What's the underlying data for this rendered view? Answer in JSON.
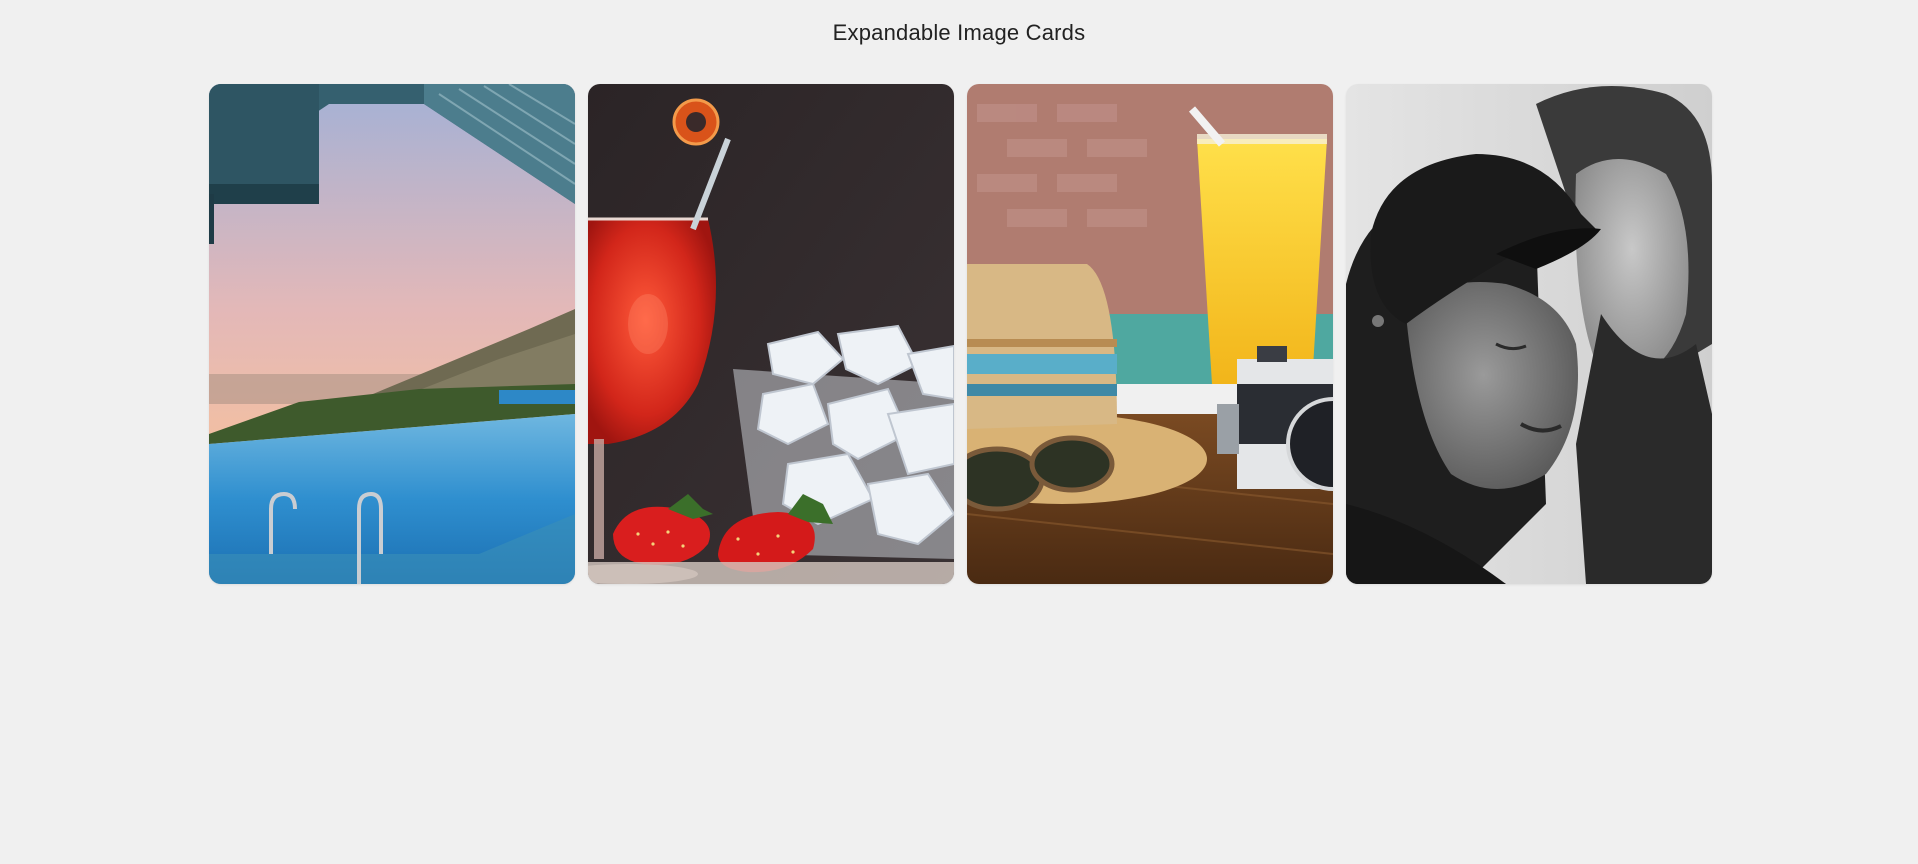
{
  "header": {
    "title": "Expandable Image Cards"
  },
  "cards": [
    {
      "image": "infinity-pool-sunset"
    },
    {
      "image": "red-cocktail-strawberries-ice"
    },
    {
      "image": "straw-hat-sunglasses-camera-juice"
    },
    {
      "image": "black-and-white-couple-portrait"
    }
  ]
}
